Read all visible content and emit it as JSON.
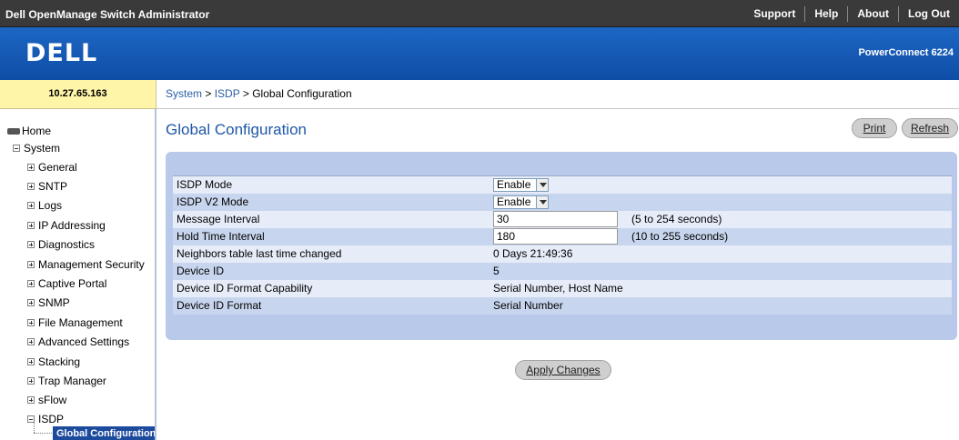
{
  "app_title": "Dell OpenManage Switch Administrator",
  "top_nav": [
    "Support",
    "Help",
    "About",
    "Log Out"
  ],
  "brand": {
    "logo": "DELL",
    "model": "PowerConnect 6224"
  },
  "ip_address": "10.27.65.163",
  "breadcrumb": {
    "system": "System",
    "sep1": ">",
    "isdp": "ISDP",
    "sep2": ">",
    "current": "Global Configuration"
  },
  "sidebar": {
    "home": "Home",
    "system": "System",
    "items": [
      "General",
      "SNTP",
      "Logs",
      "IP Addressing",
      "Diagnostics",
      "Management Security",
      "Captive Portal",
      "SNMP",
      "File Management",
      "Advanced Settings",
      "Stacking",
      "Trap Manager",
      "sFlow",
      "ISDP"
    ],
    "selected": "Global Configuration"
  },
  "page": {
    "title": "Global Configuration",
    "print_label": "Print",
    "refresh_label": "Refresh",
    "apply_label": "Apply Changes"
  },
  "form": {
    "isdp_mode": {
      "label": "ISDP Mode",
      "value": "Enable"
    },
    "isdp_v2_mode": {
      "label": "ISDP V2 Mode",
      "value": "Enable"
    },
    "message_interval": {
      "label": "Message Interval",
      "value": "30",
      "range": "(5 to 254 seconds)"
    },
    "hold_time": {
      "label": "Hold Time Interval",
      "value": "180",
      "range": "(10 to 255 seconds)"
    },
    "neighbors_changed": {
      "label": "Neighbors table last time changed",
      "value": "0 Days 21:49:36"
    },
    "device_id": {
      "label": "Device ID",
      "value": "5"
    },
    "device_id_capability": {
      "label": "Device ID Format Capability",
      "value": "Serial Number, Host Name"
    },
    "device_id_format": {
      "label": "Device ID Format",
      "value": "Serial Number"
    }
  },
  "colors": {
    "accent": "#1f57a6",
    "brand_blue": "#0e4da6",
    "panel": "#b9c9ea",
    "ip_box": "#fff5a8",
    "selected_node": "#1c4a9d"
  }
}
